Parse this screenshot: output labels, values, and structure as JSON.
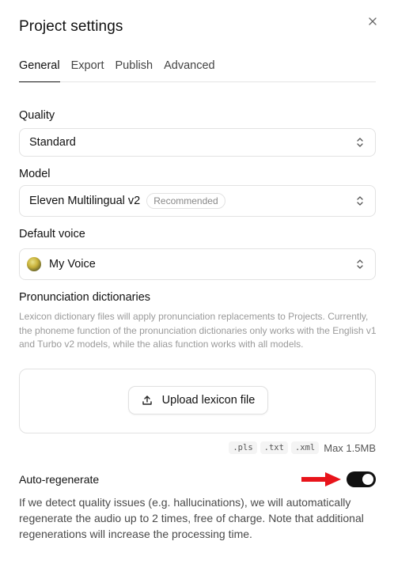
{
  "dialog": {
    "title": "Project settings"
  },
  "tabs": [
    {
      "label": "General",
      "active": true
    },
    {
      "label": "Export",
      "active": false
    },
    {
      "label": "Publish",
      "active": false
    },
    {
      "label": "Advanced",
      "active": false
    }
  ],
  "quality": {
    "label": "Quality",
    "value": "Standard"
  },
  "model": {
    "label": "Model",
    "value": "Eleven Multilingual v2",
    "badge": "Recommended"
  },
  "voice": {
    "label": "Default voice",
    "value": "My Voice"
  },
  "pronunciation": {
    "label": "Pronunciation dictionaries",
    "description": "Lexicon dictionary files will apply pronunciation replacements to Projects. Currently, the phoneme function of the pronunciation dictionaries only works with the English v1 and Turbo v2 models, while the alias function works with all models.",
    "upload_label": "Upload lexicon file",
    "formats": [
      ".pls",
      ".txt",
      ".xml"
    ],
    "max_size": "Max 1.5MB"
  },
  "auto_regenerate": {
    "label": "Auto-regenerate",
    "enabled": true,
    "description": "If we detect quality issues (e.g. hallucinations), we will automatically regenerate the audio up to 2 times, free of charge. Note that additional regenerations will increase the processing time."
  },
  "colors": {
    "accent": "#111111",
    "arrow": "#e8141b",
    "border": "#e2e2e2",
    "muted": "#9a9a9a"
  },
  "icons": {
    "close": "close-icon",
    "chevron": "chevron-up-down-icon",
    "upload": "upload-icon",
    "arrow": "red-arrow-icon"
  }
}
